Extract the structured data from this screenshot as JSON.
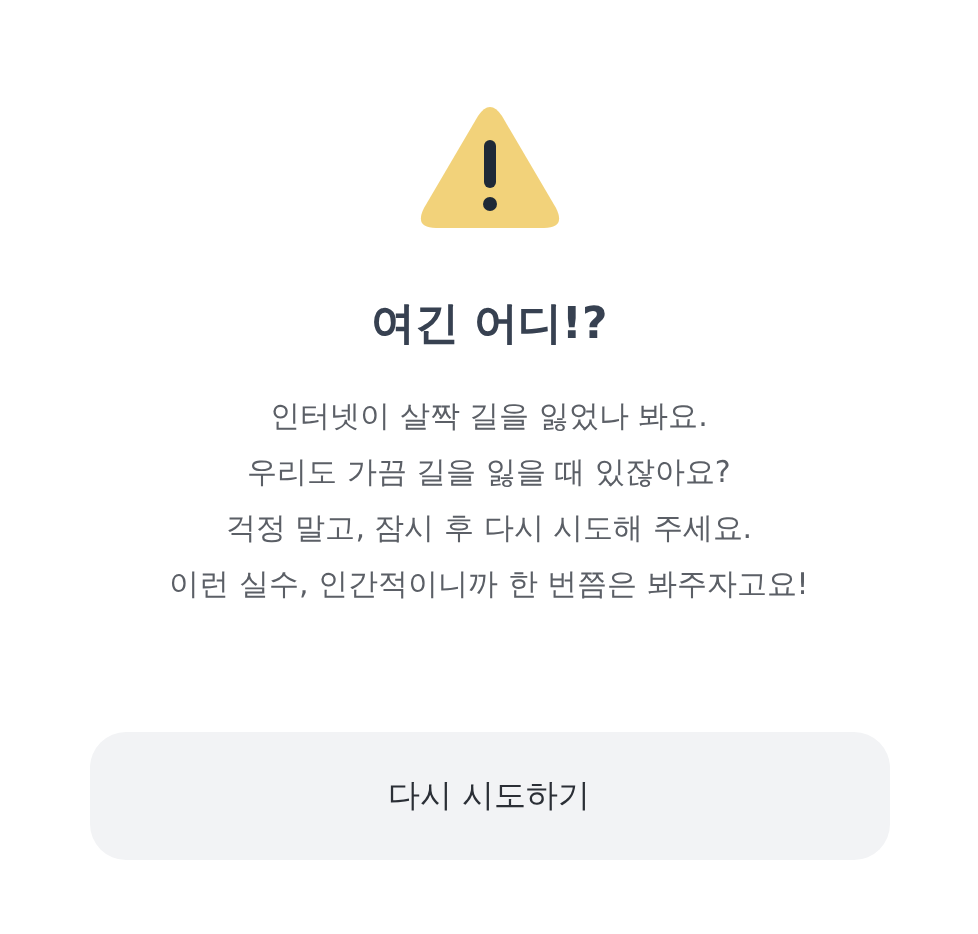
{
  "title": "여긴 어디!?",
  "message_lines": [
    "인터넷이 살짝 길을 잃었나 봐요.",
    "우리도 가끔 길을 잃을 때 있잖아요?",
    "걱정 말고, 잠시 후 다시 시도해 주세요.",
    "이런 실수, 인간적이니까 한 번쯤은 봐주자고요!"
  ],
  "button": {
    "label": "다시 시도하기"
  }
}
